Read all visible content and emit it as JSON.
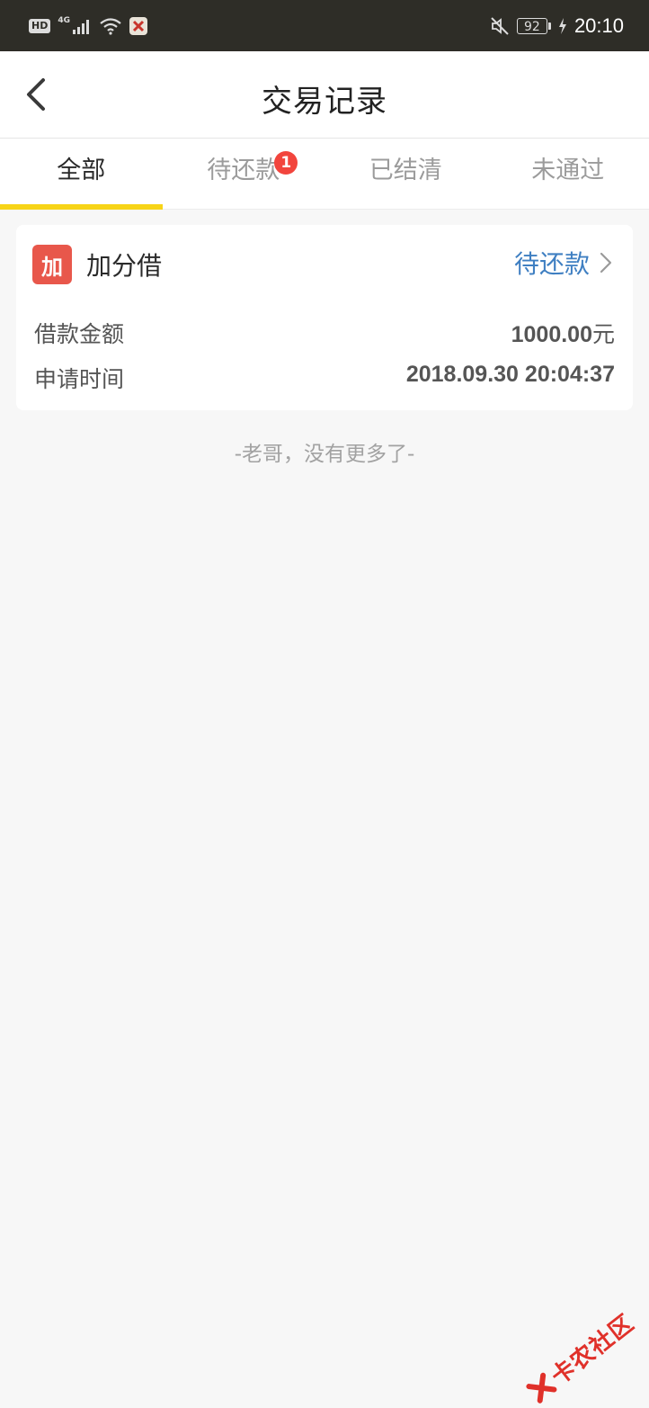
{
  "status_bar": {
    "hd_label": "HD",
    "network_label": "4G",
    "battery_level": "92",
    "time": "20:10",
    "icons": [
      "signal-icon",
      "wifi-icon",
      "app-notification-icon",
      "mute-icon",
      "battery-icon",
      "charging-icon"
    ]
  },
  "header": {
    "title": "交易记录",
    "back_icon": "back-arrow-icon"
  },
  "tabs": [
    {
      "label": "全部",
      "active": true
    },
    {
      "label": "待还款",
      "active": false,
      "badge": "1"
    },
    {
      "label": "已结清",
      "active": false
    },
    {
      "label": "未通过",
      "active": false
    }
  ],
  "records": [
    {
      "logo_text": "加",
      "product_name": "加分借",
      "status": "待还款",
      "amount_label": "借款金额",
      "amount_value": "1000.00",
      "amount_unit": "元",
      "time_label": "申请时间",
      "time_value": "2018.09.30 20:04:37"
    }
  ],
  "footer_text": "-老哥，没有更多了-",
  "watermark": {
    "text": "卡农社区"
  },
  "colors": {
    "status_bar_bg": "#2e2d27",
    "tab_indicator": "#f7d417",
    "badge_red": "#f2453d",
    "logo_red": "#e8574b",
    "status_blue": "#3f7fc2",
    "page_bg": "#f7f7f7"
  }
}
